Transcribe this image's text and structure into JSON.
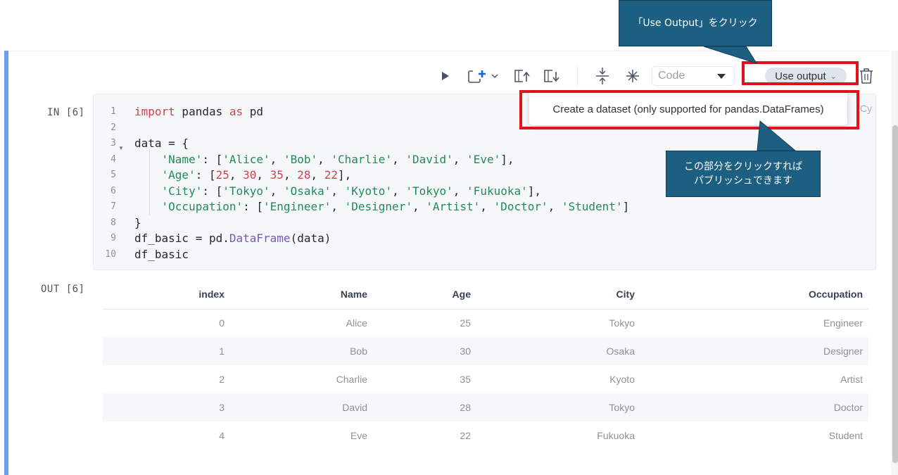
{
  "toolbar": {
    "run_icon": "play-icon",
    "add_cell_icon": "add-cell-icon",
    "move_up_icon": "move-cell-up-icon",
    "move_down_icon": "move-cell-down-icon",
    "collapse_icon": "collapse-icon",
    "expand_icon": "expand-icon",
    "cell_type": "Code",
    "use_output_label": "Use output",
    "delete_icon": "trash-icon"
  },
  "dropdown": {
    "item": "Create a dataset (only supported for pandas.DataFrames)"
  },
  "annotations": {
    "callout_top": "「Use Output」をクリック",
    "callout_bottom_line1": "この部分をクリックすれば",
    "callout_bottom_line2": "パブリッシュできます",
    "highlight_color": "#e0121b",
    "callout_color": "#1d5f80"
  },
  "cell": {
    "in_label": "IN [6]",
    "out_label": "OUT [6]",
    "copy_hint": "Cy",
    "line_numbers": [
      "1",
      "2",
      "3",
      "4",
      "5",
      "6",
      "7",
      "8",
      "9",
      "10"
    ],
    "code": {
      "l1_kw1": "import",
      "l1_mod": " pandas ",
      "l1_kw2": "as",
      "l1_alias": " pd",
      "l3": "data = {",
      "l4_key": "'Name'",
      "l4_p1": ": [",
      "l4_v1": "'Alice'",
      "l4_v2": "'Bob'",
      "l4_v3": "'Charlie'",
      "l4_v4": "'David'",
      "l4_v5": "'Eve'",
      "l4_end": "],",
      "l5_key": "'Age'",
      "l5_p1": ": [",
      "l5_v1": "25",
      "l5_v2": "30",
      "l5_v3": "35",
      "l5_v4": "28",
      "l5_v5": "22",
      "l5_end": "],",
      "l6_key": "'City'",
      "l6_p1": ": [",
      "l6_v1": "'Tokyo'",
      "l6_v2": "'Osaka'",
      "l6_v3": "'Kyoto'",
      "l6_v4": "'Tokyo'",
      "l6_v5": "'Fukuoka'",
      "l6_end": "],",
      "l7_key": "'Occupation'",
      "l7_p1": ": [",
      "l7_v1": "'Engineer'",
      "l7_v2": "'Designer'",
      "l7_v3": "'Artist'",
      "l7_v4": "'Doctor'",
      "l7_v5": "'Student'",
      "l7_end": "]",
      "l8": "}",
      "l9_a": "df_basic = pd.",
      "l9_fn": "DataFrame",
      "l9_b": "(data)",
      "l10": "df_basic"
    }
  },
  "output_table": {
    "headers": [
      "index",
      "Name",
      "Age",
      "City",
      "Occupation"
    ],
    "rows": [
      [
        "0",
        "Alice",
        "25",
        "Tokyo",
        "Engineer"
      ],
      [
        "1",
        "Bob",
        "30",
        "Osaka",
        "Designer"
      ],
      [
        "2",
        "Charlie",
        "35",
        "Kyoto",
        "Artist"
      ],
      [
        "3",
        "David",
        "28",
        "Tokyo",
        "Doctor"
      ],
      [
        "4",
        "Eve",
        "22",
        "Fukuoka",
        "Student"
      ]
    ]
  }
}
